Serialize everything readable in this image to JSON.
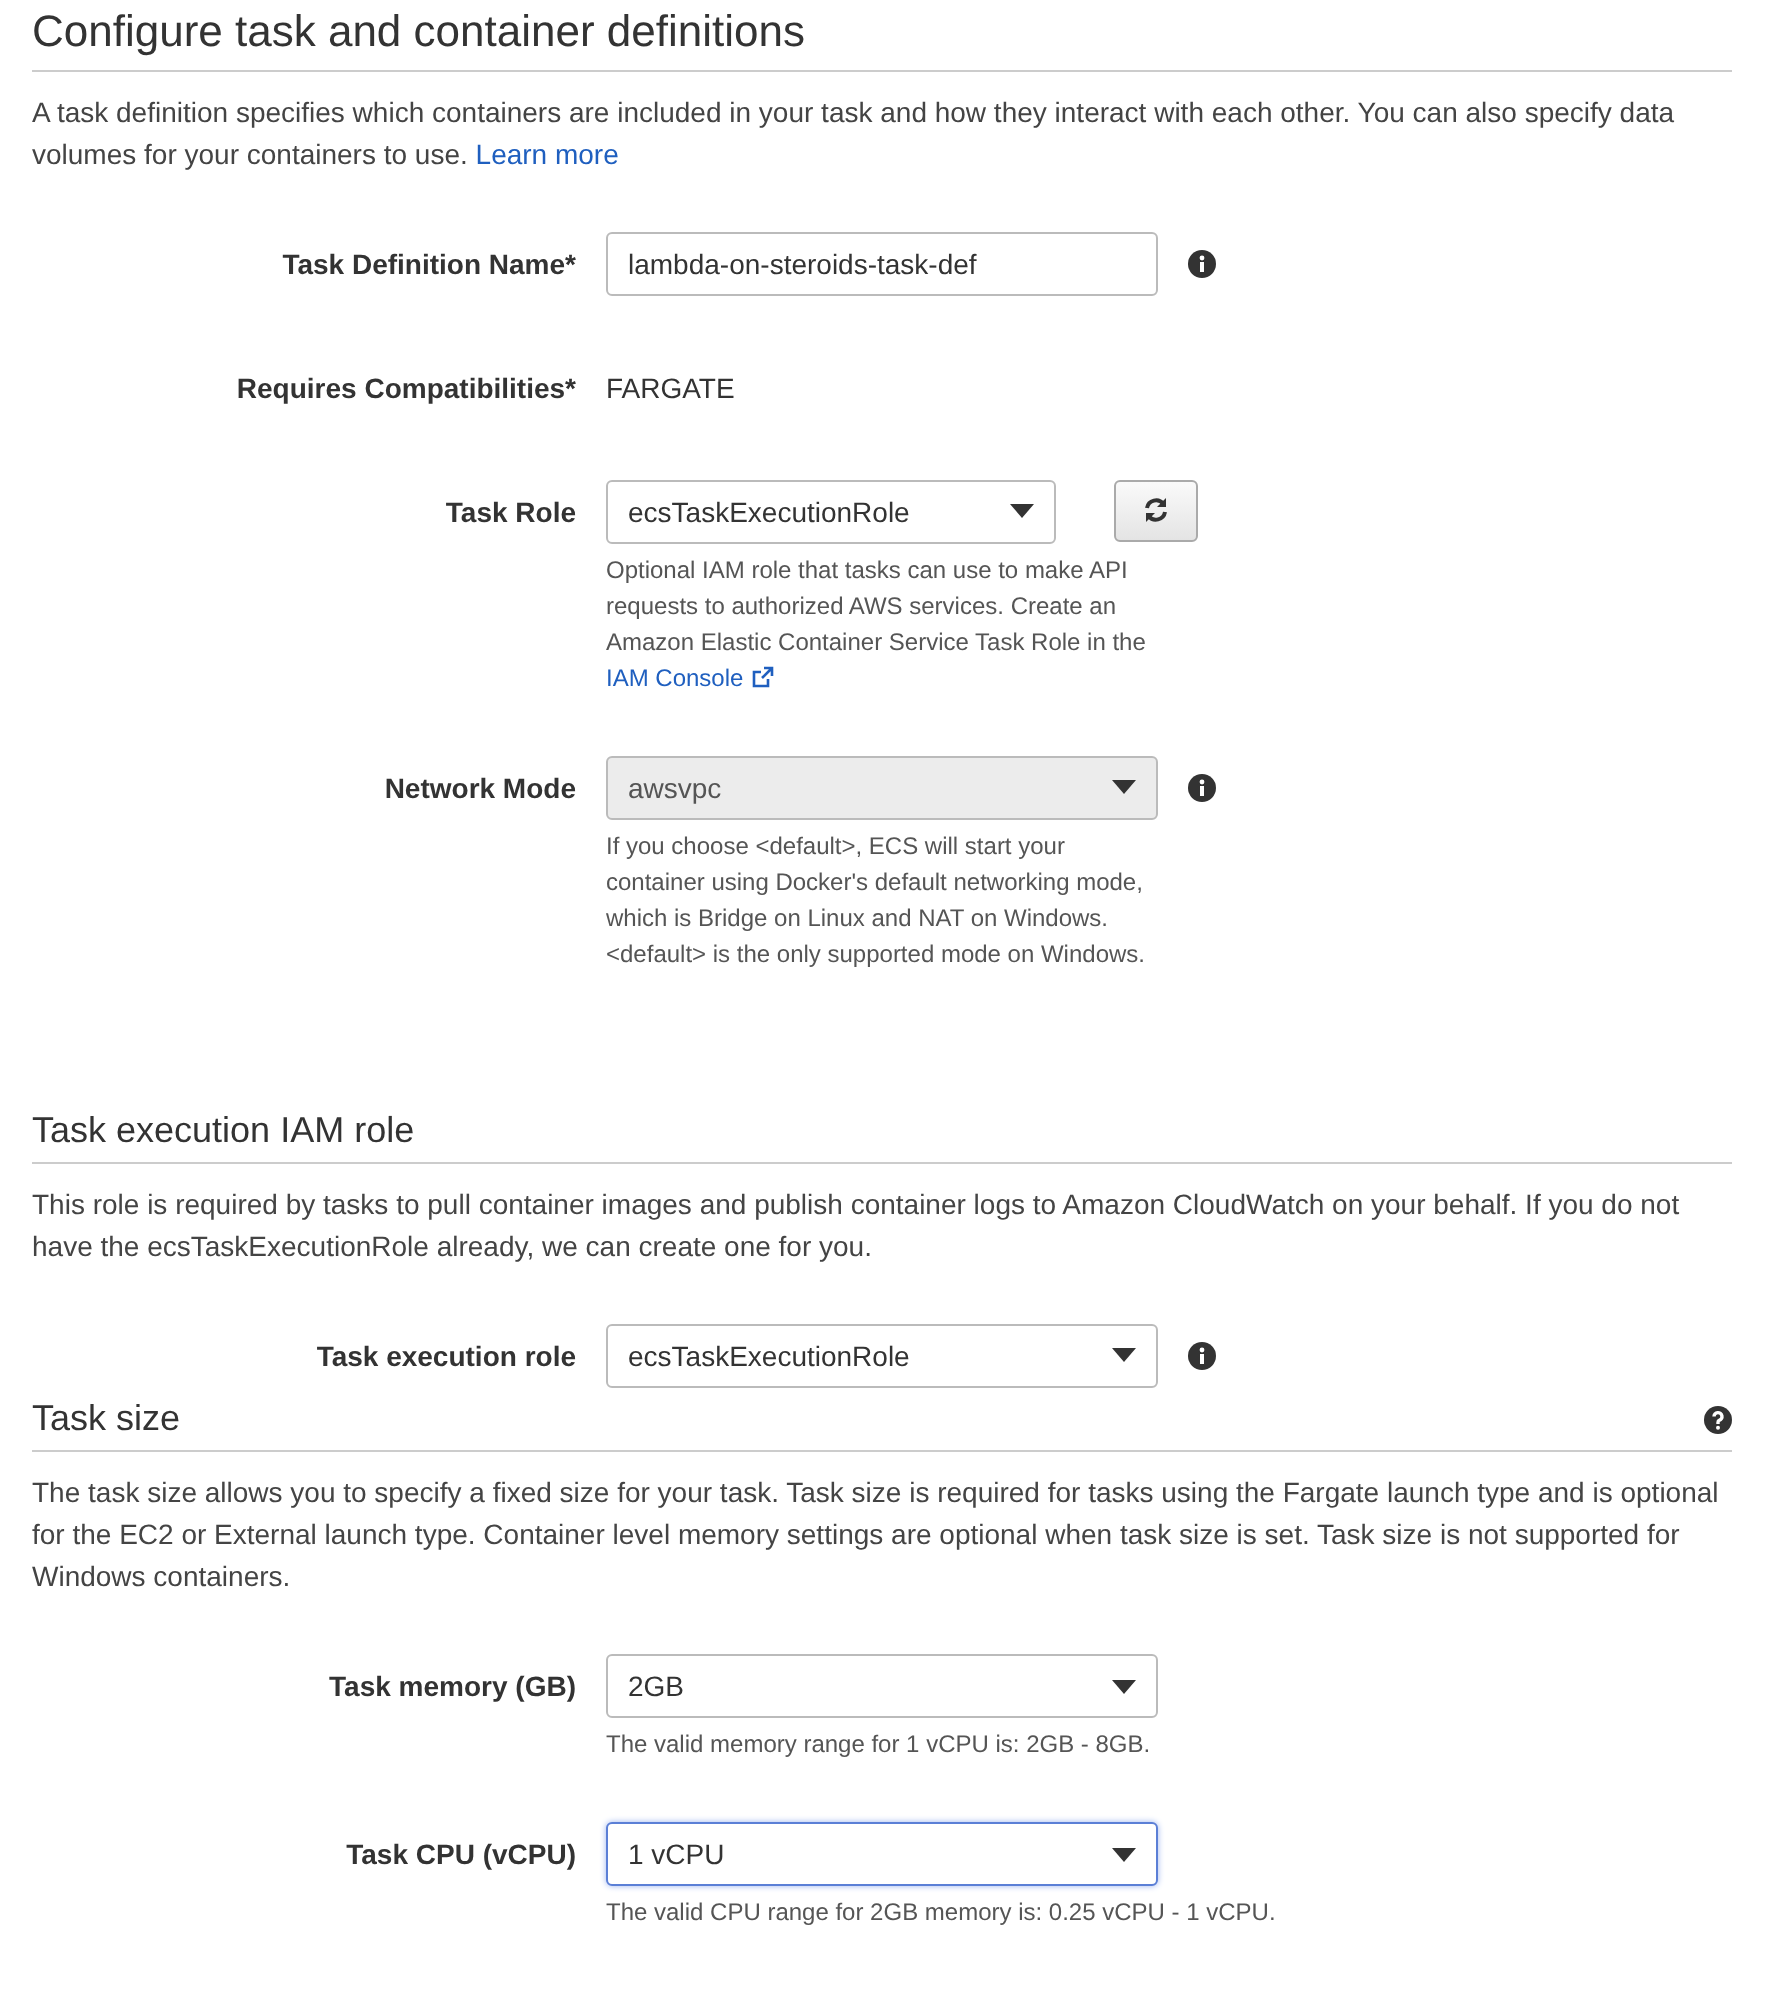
{
  "sections": [
    {
      "title": "Configure task and container definitions",
      "kind": "main",
      "help_icon": false,
      "description": "A task definition specifies which containers are included in your task and how they interact with each other. You can also specify data volumes for your containers to use.",
      "description_link": "Learn more",
      "fields": [
        {
          "kind": "text",
          "label": "Task Definition Name*",
          "value": "lambda-on-steroids-task-def",
          "info_icon": true
        },
        {
          "kind": "static",
          "label": "Requires Compatibilities*",
          "value": "FARGATE",
          "info_icon": false
        },
        {
          "kind": "select",
          "label": "Task Role",
          "value": "ecsTaskExecutionRole",
          "disabled": false,
          "focused": false,
          "info_icon": false,
          "refresh_button": true,
          "help": [
            "Optional IAM role that tasks can use to make API",
            "requests to authorized AWS services. Create an",
            "Amazon Elastic Container Service Task Role in the"
          ],
          "help_link": "IAM Console"
        },
        {
          "kind": "select",
          "label": "Network Mode",
          "value": "awsvpc",
          "disabled": true,
          "focused": false,
          "info_icon": true,
          "help": [
            "If you choose <default>, ECS will start your",
            "container using Docker's default networking mode,",
            "which is Bridge on Linux and NAT on Windows.",
            "<default> is the only supported mode on Windows."
          ]
        }
      ]
    },
    {
      "title": "Task execution IAM role",
      "kind": "sub",
      "help_icon": false,
      "description": "This role is required by tasks to pull container images and publish container logs to Amazon CloudWatch on your behalf. If you do not have the ecsTaskExecutionRole already, we can create one for you.",
      "fields": [
        {
          "kind": "select",
          "label": "Task execution role",
          "value": "ecsTaskExecutionRole",
          "disabled": false,
          "focused": false,
          "info_icon": true
        }
      ]
    },
    {
      "title": "Task size",
      "kind": "sub",
      "help_icon": true,
      "description": "The task size allows you to specify a fixed size for your task. Task size is required for tasks using the Fargate launch type and is optional for the EC2 or External launch type. Container level memory settings are optional when task size is set. Task size is not supported for Windows containers.",
      "fields": [
        {
          "kind": "select",
          "label": "Task memory (GB)",
          "value": "2GB",
          "disabled": false,
          "focused": false,
          "info_icon": false,
          "help": [
            "The valid memory range for 1 vCPU is: 2GB - 8GB."
          ]
        },
        {
          "kind": "select",
          "label": "Task CPU (vCPU)",
          "value": "1 vCPU",
          "disabled": false,
          "focused": true,
          "info_icon": false,
          "help": [
            "The valid CPU range for 2GB memory is: 0.25 vCPU - 1 vCPU."
          ]
        }
      ]
    }
  ]
}
